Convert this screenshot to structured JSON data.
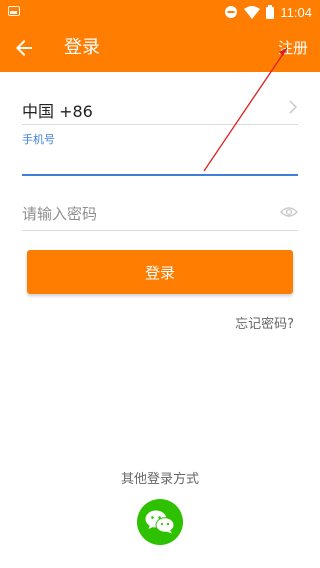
{
  "status_bar": {
    "time": "11:04",
    "icons": [
      "image-icon",
      "minus-circle-icon",
      "wifi-icon",
      "battery-icon"
    ]
  },
  "toolbar": {
    "title": "登录",
    "register_label": "注册",
    "back_icon": "back-arrow-icon"
  },
  "form": {
    "country": "中国 +86",
    "phone_label": "手机号",
    "phone_value": "",
    "password_placeholder": "请输入密码",
    "login_label": "登录",
    "forgot_label": "忘记密码?"
  },
  "social": {
    "label": "其他登录方式",
    "wechat_icon": "wechat-icon"
  },
  "colors": {
    "primary": "#ff7d00",
    "focus": "#3f7fdc",
    "wechat": "#2dc100",
    "annotation": "#e02020"
  }
}
